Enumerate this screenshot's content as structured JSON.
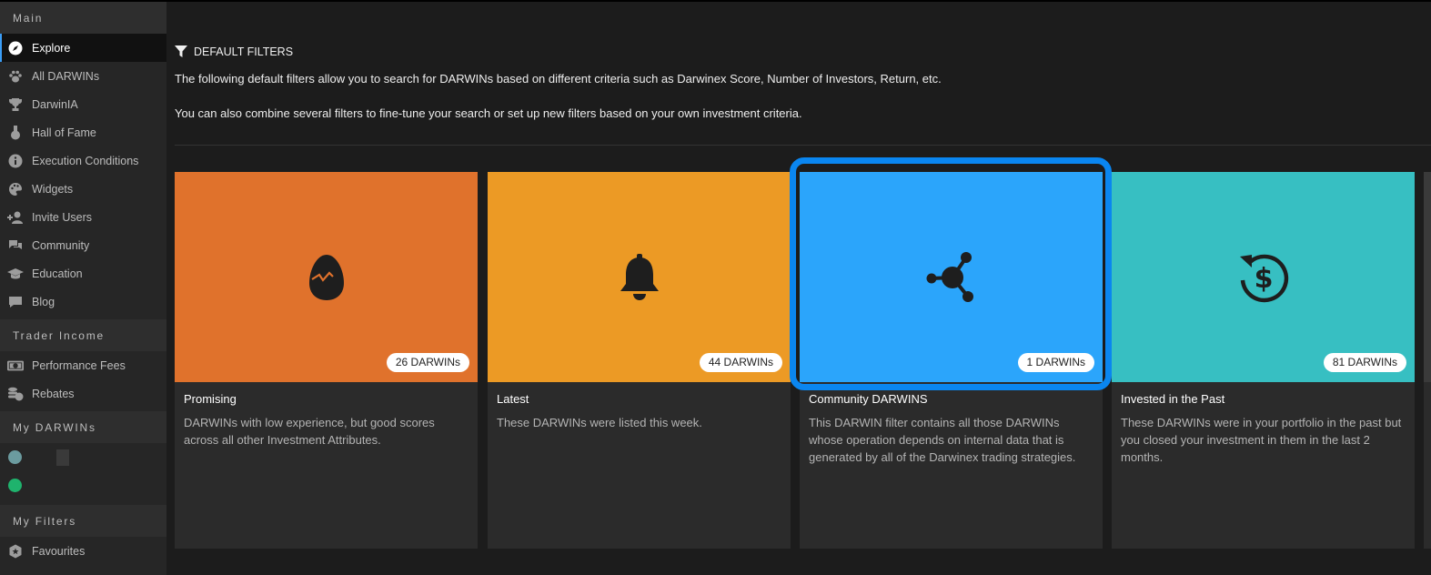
{
  "sidebar": {
    "main_header": "Main",
    "main_items": [
      {
        "label": "Explore",
        "icon": "compass-icon"
      },
      {
        "label": "All DARWINs",
        "icon": "paw-icon"
      },
      {
        "label": "DarwinIA",
        "icon": "trophy-icon"
      },
      {
        "label": "Hall of Fame",
        "icon": "medal-icon"
      },
      {
        "label": "Execution Conditions",
        "icon": "info-icon"
      },
      {
        "label": "Widgets",
        "icon": "palette-icon"
      },
      {
        "label": "Invite Users",
        "icon": "user-plus-icon"
      },
      {
        "label": "Community",
        "icon": "chat-bubbles-icon"
      },
      {
        "label": "Education",
        "icon": "graduation-cap-icon"
      },
      {
        "label": "Blog",
        "icon": "comment-icon"
      }
    ],
    "trader_header": "Trader Income",
    "trader_items": [
      {
        "label": "Performance Fees",
        "icon": "money-bill-icon"
      },
      {
        "label": "Rebates",
        "icon": "coins-icon"
      }
    ],
    "my_darwins_header": "My DARWINs",
    "my_filters_header": "My Filters",
    "filter_items": [
      {
        "label": "Favourites",
        "icon": "shield-star-icon"
      }
    ]
  },
  "main": {
    "section_title": "DEFAULT FILTERS",
    "description_1": "The following default filters allow you to search for DARWINs based on different criteria such as Darwinex Score, Number of Investors, Return, etc.",
    "description_2": "You can also combine several filters to fine-tune your search or set up new filters based on your own investment criteria.",
    "cards": [
      {
        "title": "Promising",
        "badge": "26 DARWINs",
        "description": "DARWINs with low experience, but good scores across all other Investment Attributes.",
        "color": "#e0722c",
        "icon": "cracked-egg-icon"
      },
      {
        "title": "Latest",
        "badge": "44 DARWINs",
        "description": "These DARWINs were listed this week.",
        "color": "#ec9a25",
        "icon": "bell-icon"
      },
      {
        "title": "Community DARWINS",
        "badge": "1 DARWINs",
        "description": "This DARWIN filter contains all those DARWINs whose operation depends on internal data that is generated by all of the Darwinex trading strategies.",
        "color": "#2ba5fb",
        "icon": "network-hub-icon"
      },
      {
        "title": "Invested in the Past",
        "badge": "81 DARWINs",
        "description": "These DARWINs were in your portfolio in the past but you closed your investment in them in the last 2 months.",
        "color": "#37bfc2",
        "icon": "dollar-history-icon"
      }
    ]
  },
  "colors": {
    "sidebar_bg": "#262626",
    "main_bg": "#1c1c1c",
    "highlight": "#0a86f0",
    "dot_teal": "#6b9b9f",
    "dot_green": "#1fb36d"
  }
}
